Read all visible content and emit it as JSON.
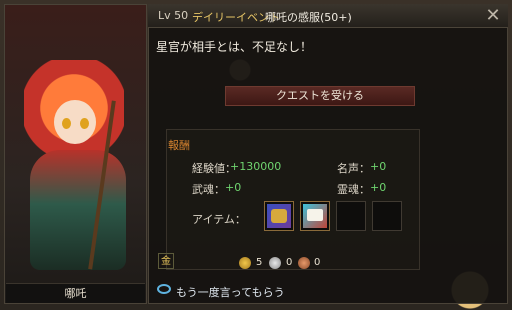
{
  "header": {
    "level": "Lv 50",
    "event_type": "デイリーイベント",
    "quest_title": "哪吒の感服(50+)",
    "close_symbol": "✕"
  },
  "dialogue": "星官が相手とは、不足なし！",
  "accept_button": "クエストを受ける",
  "rewards": {
    "title": "報酬",
    "exp_label": "経験値：",
    "exp_value": "+130000",
    "fame_label": "名声：",
    "fame_value": "+0",
    "martial_soul_label": "武魂：",
    "martial_soul_value": "+0",
    "spirit_soul_label": "霊魂：",
    "spirit_soul_value": "+0",
    "items_label": "アイテム：",
    "gold_badge": "金",
    "coins": {
      "gold": "5",
      "silver": "0",
      "copper": "0"
    }
  },
  "character_name": "哪吒",
  "footer_link": "もう一度言ってもらう",
  "colors": {
    "event_text": "#e6c566",
    "reward_title": "#d9842f",
    "positive_value": "#6fd46f",
    "accept_button": "#5a2a24"
  },
  "icons": [
    "close-icon",
    "chat-icon",
    "gold-coin-icon",
    "silver-coin-icon",
    "copper-coin-icon"
  ]
}
